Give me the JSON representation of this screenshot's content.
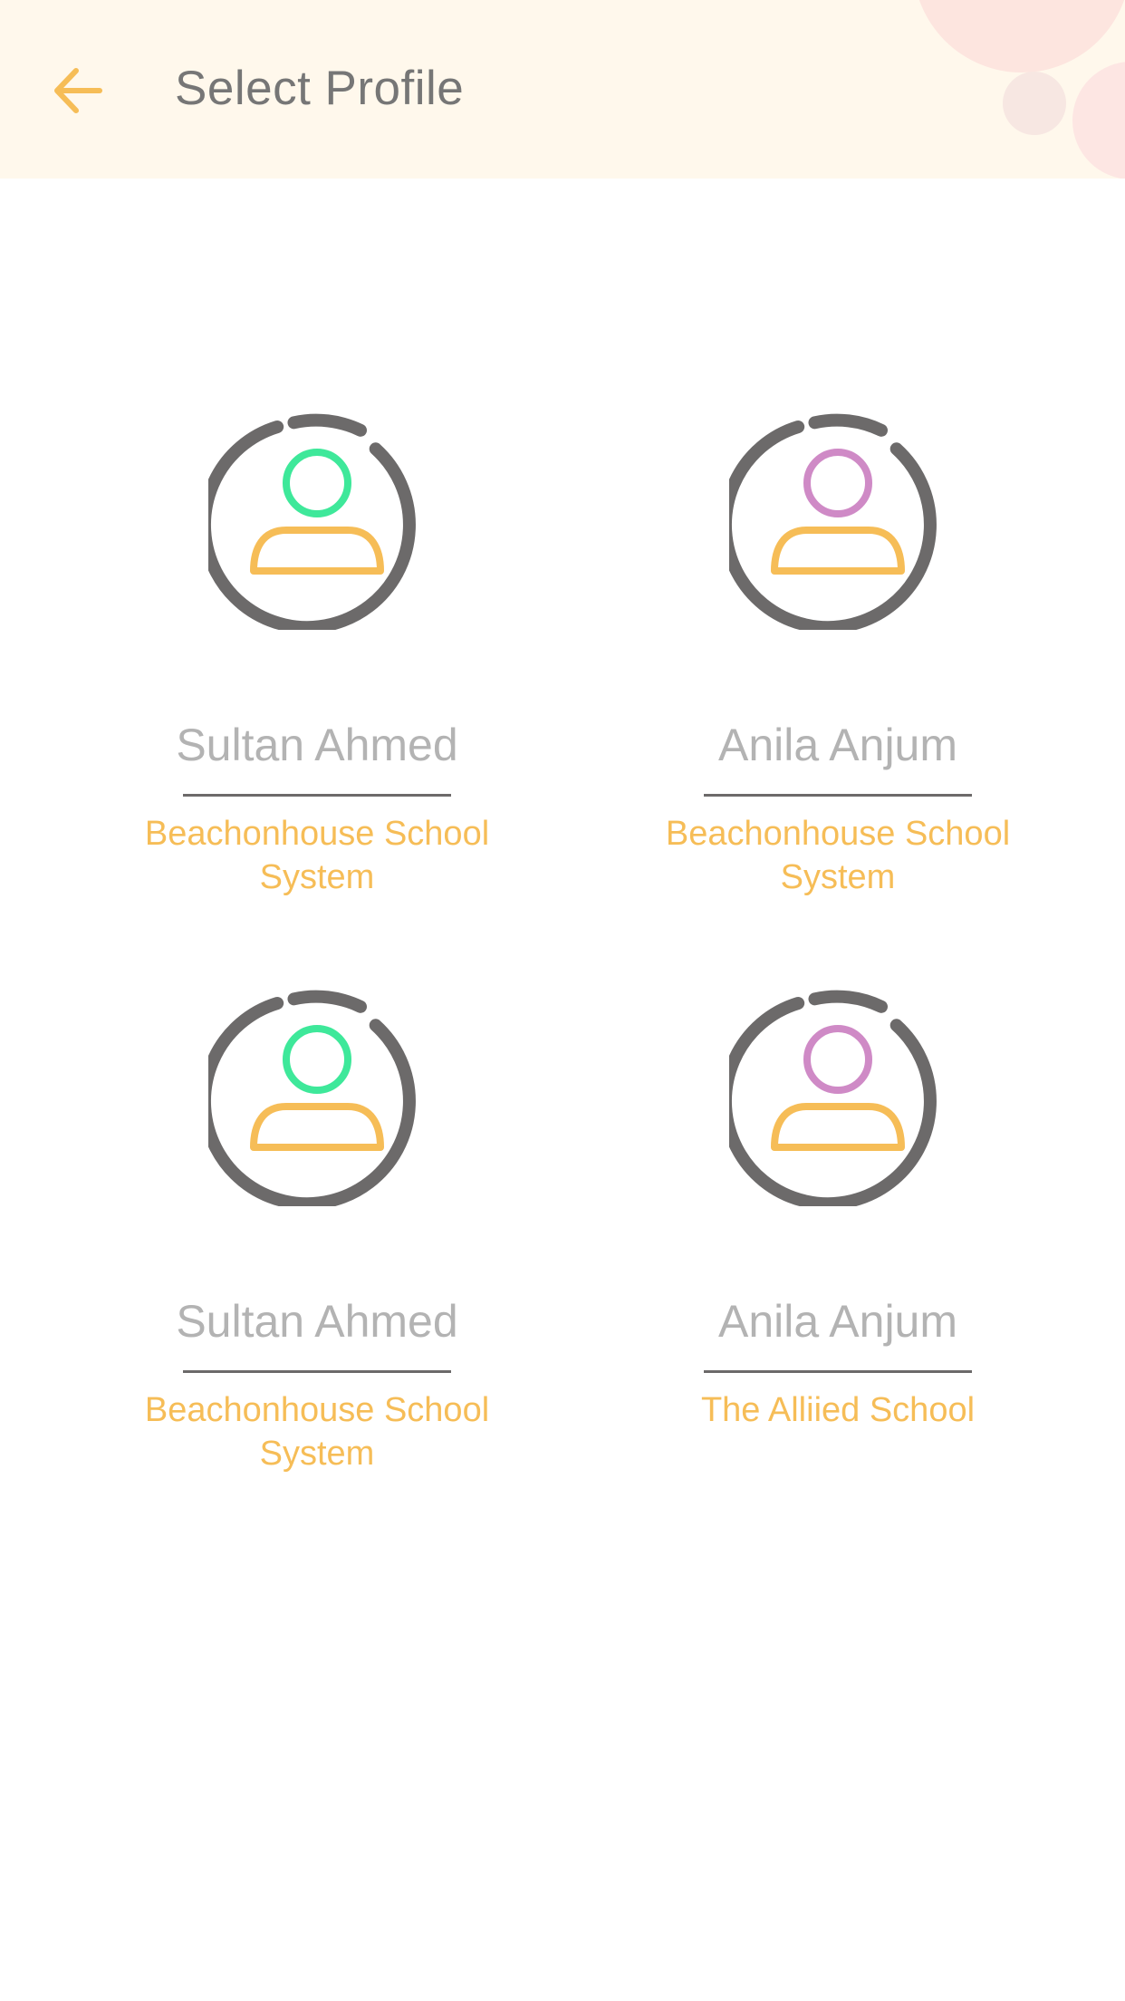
{
  "header": {
    "title": "Select Profile",
    "back_icon": "arrow-left-icon"
  },
  "colors": {
    "accent": "#f6bd57",
    "header_bg": "#fff8ec",
    "ring": "#6c6a6a",
    "head_green": "#3ee89a",
    "head_purple": "#cf8ac6",
    "name_text": "#b3b3b3",
    "title_text": "#767676"
  },
  "profiles": [
    {
      "name": "Sultan Ahmed",
      "school": "Beachonhouse School System",
      "avatar_color": "green"
    },
    {
      "name": "Anila Anjum",
      "school": "Beachonhouse School System",
      "avatar_color": "purple"
    },
    {
      "name": "Sultan Ahmed",
      "school": "Beachonhouse School System",
      "avatar_color": "green"
    },
    {
      "name": "Anila Anjum",
      "school": "The Alliied School",
      "avatar_color": "purple"
    }
  ]
}
